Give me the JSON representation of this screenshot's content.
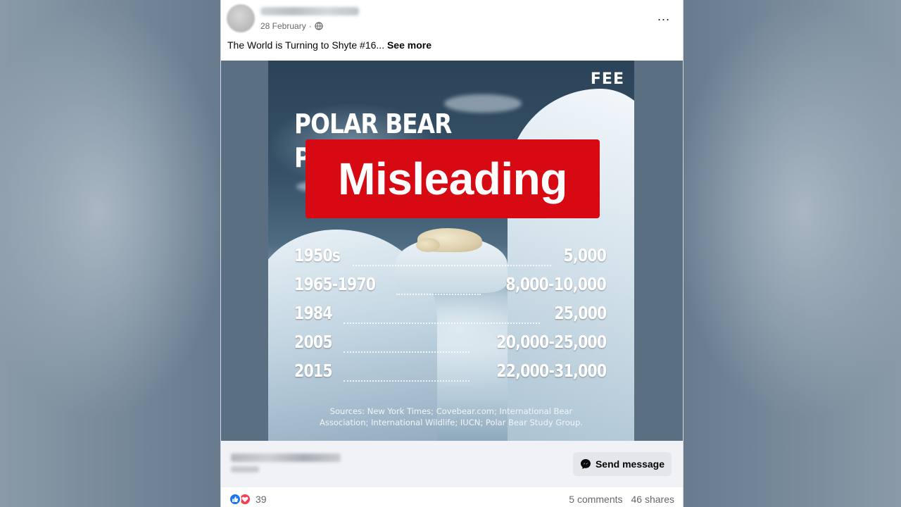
{
  "post": {
    "author": "",
    "date": "28 February",
    "caption": "The World is Turning to Shyte #16...",
    "see_more": "See more",
    "more_icon": "..."
  },
  "image": {
    "logo": "FEE",
    "title_line1": "POLAR BEAR",
    "title_line2": "P",
    "overlay_label": "Misleading",
    "rows": [
      {
        "period": "1950s",
        "count": "5,000"
      },
      {
        "period": "1965-1970",
        "count": "8,000-10,000"
      },
      {
        "period": "1984",
        "count": "25,000"
      },
      {
        "period": "2005",
        "count": "20,000-25,000"
      },
      {
        "period": "2015",
        "count": "22,000-31,000"
      }
    ],
    "sources_line1": "Sources: New York Times; Covebear.com; International Bear",
    "sources_line2": "Association; International Wildlife; IUCN; Polar Bear Study Group."
  },
  "profile_bar": {
    "send_message": "Send message"
  },
  "footer": {
    "reaction_count": "39",
    "comments": "5 comments",
    "shares": "46 shares"
  },
  "colors": {
    "badge_red": "#d70a14",
    "like_blue": "#1877f2",
    "love_red": "#f33e58"
  }
}
